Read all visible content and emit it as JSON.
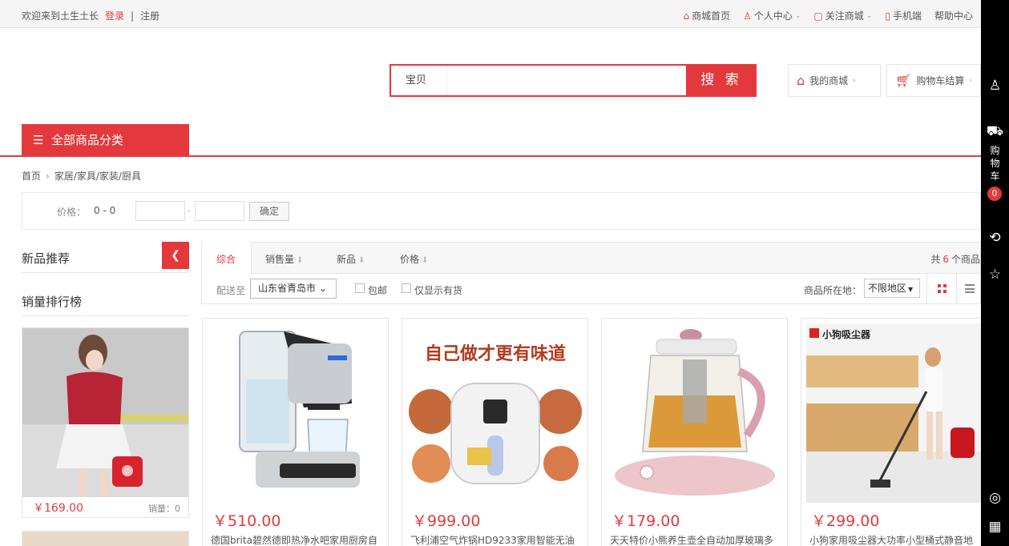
{
  "colors": {
    "accent": "#e4393c",
    "toolbar": "#000000"
  },
  "topbar": {
    "welcome": "欢迎来到土生土长",
    "login": "登录",
    "separator": "|",
    "register": "注册",
    "links": {
      "home": "商城首页",
      "user_center": "个人中心",
      "follow": "关注商城",
      "mobile": "手机端",
      "help": "帮助中心"
    }
  },
  "search": {
    "category": "宝贝",
    "value": "",
    "button": "搜 索"
  },
  "header_buttons": {
    "my_mall": "我的商城",
    "cart_checkout": "购物车结算"
  },
  "nav": {
    "all_categories": "全部商品分类"
  },
  "breadcrumb": {
    "home": "首页",
    "category": "家居/家具/家装/厨具"
  },
  "price_filter": {
    "label": "价格：",
    "range": "0 - 0",
    "dash": "-",
    "confirm": "确定"
  },
  "sidebar": {
    "new_recommend": "新品推荐",
    "sales_rank": "销量排行榜",
    "card": {
      "price": "￥169.00",
      "sales": "销量：0"
    }
  },
  "sort": {
    "items": [
      "综合",
      "销售量",
      "新品",
      "价格"
    ],
    "count_prefix": "共",
    "count": "6",
    "count_suffix": "个商品"
  },
  "filter": {
    "ship_to_label": "配送至",
    "ship_to": "山东省青岛市",
    "free_ship": "包邮",
    "in_stock": "仅显示有货",
    "location_label": "商品所在地：",
    "location": "不限地区"
  },
  "products": [
    {
      "price": "￥510.00",
      "name": "德国brita碧然德即热净水吧家用厨房自"
    },
    {
      "price": "￥999.00",
      "name": "飞利浦空气炸锅HD9233家用智能无油",
      "banner": "自己做才更有味道"
    },
    {
      "price": "￥179.00",
      "name": "天天特价小熊养生壶全自动加厚玻璃多"
    },
    {
      "price": "￥299.00",
      "name": "小狗家用吸尘器大功率小型桶式静音地",
      "brand": "小狗吸尘器"
    }
  ],
  "toolbar": {
    "cart_label": "购物车",
    "cart_count": "0"
  }
}
